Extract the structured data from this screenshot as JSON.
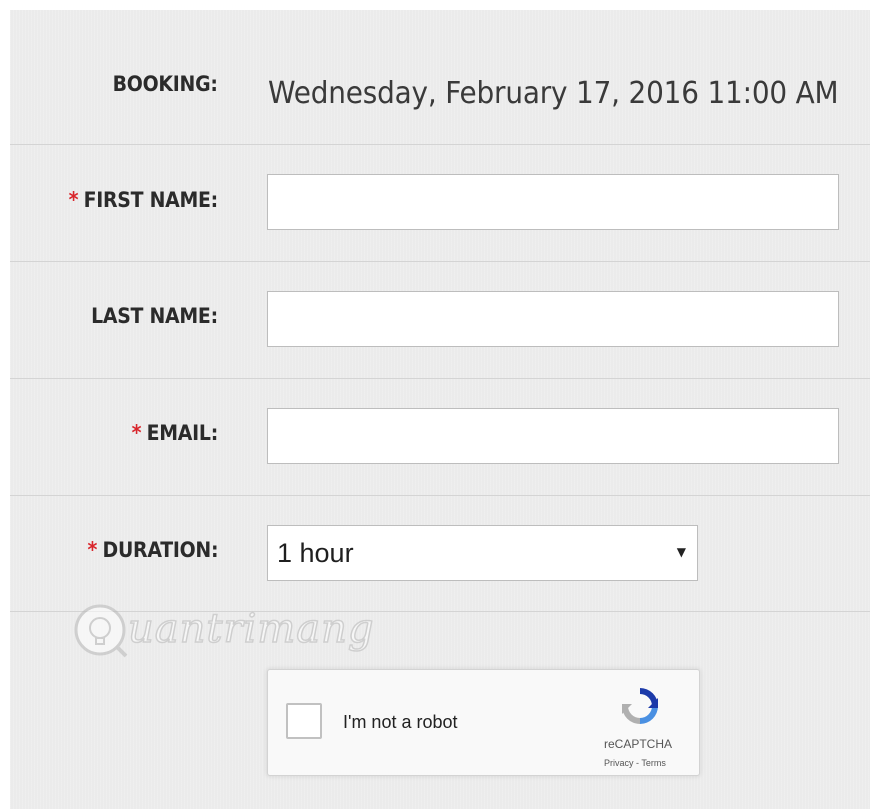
{
  "booking": {
    "label": "BOOKING:",
    "value": "Wednesday, February 17, 2016 11:00 AM"
  },
  "form": {
    "first_name": {
      "label": "FIRST NAME:",
      "required": true,
      "value": ""
    },
    "last_name": {
      "label": "LAST NAME:",
      "required": false,
      "value": ""
    },
    "email": {
      "label": "EMAIL:",
      "required": true,
      "value": ""
    },
    "duration": {
      "label": "DURATION:",
      "required": true,
      "selected": "1 hour"
    },
    "required_marker": "*"
  },
  "watermark": {
    "text": "uantrimang"
  },
  "captcha": {
    "checkbox_label": "I'm not a robot",
    "brand": "reCAPTCHA",
    "privacy": "Privacy",
    "separator": " - ",
    "terms": "Terms",
    "checked": false
  },
  "colors": {
    "background": "#ebebeb",
    "required": "#d9262c",
    "label": "#2b2b2b",
    "recaptcha_blue": "#1c3aa9",
    "recaptcha_light_blue": "#4a90e2",
    "recaptcha_gray": "#b0b0b0"
  }
}
